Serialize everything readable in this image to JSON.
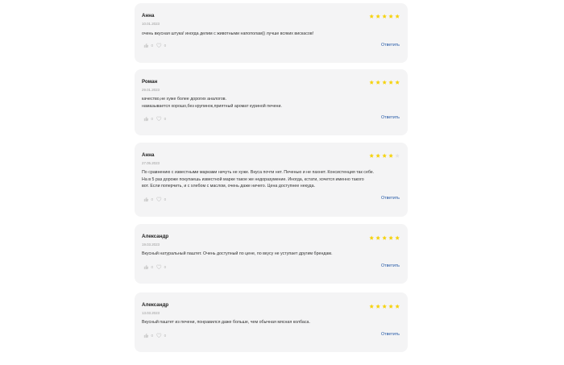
{
  "colors": {
    "star_filled": "#f5d312",
    "star_empty": "#e4e4e4",
    "reply": "#2458a6",
    "card_bg": "#f4f4f5"
  },
  "icons": {
    "like": "thumbs-up-icon",
    "favorite": "heart-icon",
    "rating": "star-icon"
  },
  "reviews": [
    {
      "author": "Анна",
      "date": "10.01.2023",
      "rating": 5,
      "lines": [
        "очень вкусная штука! иногда делим с животными напополам)) лучше всяких вискасов!"
      ],
      "likes": "0",
      "hearts": "0",
      "reply_label": "Ответить"
    },
    {
      "author": "Роман",
      "date": "29.01.2023",
      "rating": 5,
      "lines": [
        "качество,не хуже более дорогих аналогов.",
        "намазывается хорошо,без крупинок,приятный аромат куриной печени."
      ],
      "likes": "0",
      "hearts": "0",
      "reply_label": "Ответить"
    },
    {
      "author": "Анна",
      "date": "27.05.2023",
      "rating": 4,
      "lines": [
        "По сравнению с известными марками ничуть не хуже. Вкуса почти нет. Печенью и не пахнет. Консистенция так себе.",
        "На в 5 раз дороже покупаешь известной марке такое же недоразумение. Иногда, кстати, хочется именно такого",
        "вот. Если поперчить, и с хлебом с маслом, очень даже ничего. Цена доступнее некуда."
      ],
      "likes": "0",
      "hearts": "0",
      "reply_label": "Ответить"
    },
    {
      "author": "Александр",
      "date": "19.03.2023",
      "rating": 5,
      "lines": [
        "Вкусный натуральный паштет. Очень доступный по цене, по вкусу не уступает другим брендам."
      ],
      "likes": "0",
      "hearts": "0",
      "reply_label": "Ответить"
    },
    {
      "author": "Александр",
      "date": "13.03.2023",
      "rating": 5,
      "lines": [
        "Вкусный паштет из печени, понравился даже больше, чем обычная мясная колбаса."
      ],
      "likes": "0",
      "hearts": "0",
      "reply_label": "Ответить"
    }
  ]
}
